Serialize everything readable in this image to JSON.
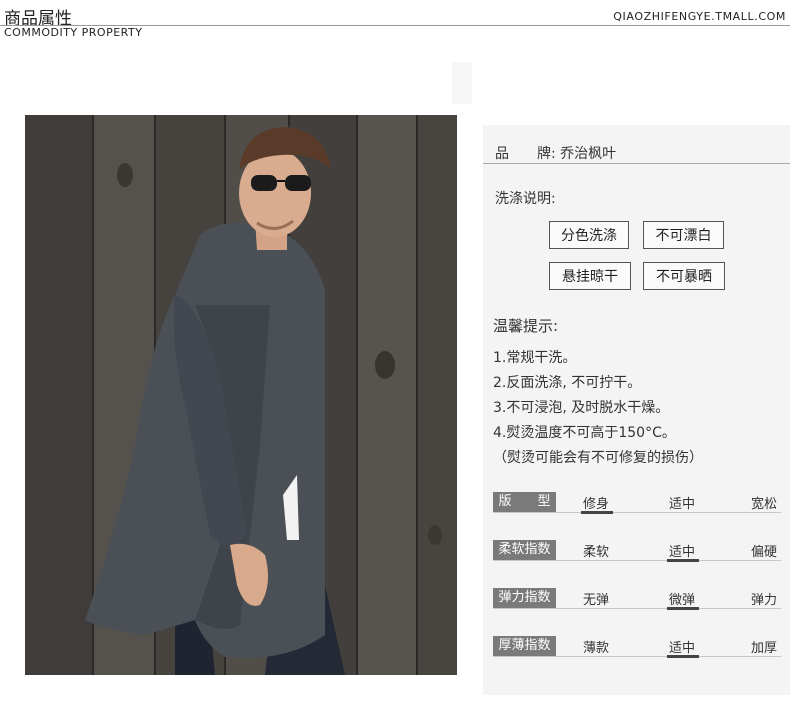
{
  "header": {
    "title": "商品属性",
    "subtitle": "COMMODITY  PROPERTY",
    "url": "QIAOZHIFENGYE.TMALL.COM"
  },
  "product": {
    "brand_line": "品　　牌: 乔治枫叶"
  },
  "wash": {
    "title": "洗涤说明:",
    "badges": [
      "分色洗涤",
      "不可漂白",
      "悬挂晾干",
      "不可暴晒"
    ]
  },
  "tips": {
    "title": "温馨提示:",
    "items": [
      "1.常规干洗。",
      "2.反面洗涤, 不可拧干。",
      "3.不可浸泡, 及时脱水干燥。",
      "4.熨烫温度不可高于150°C。",
      "（熨烫可能会有不可修复的损伤）"
    ]
  },
  "attributes": [
    {
      "label": "版　　型",
      "options": [
        "修身",
        "适中",
        "宽松"
      ],
      "selected": 0
    },
    {
      "label": "柔软指数",
      "options": [
        "柔软",
        "适中",
        "偏硬"
      ],
      "selected": 1
    },
    {
      "label": "弹力指数",
      "options": [
        "无弹",
        "微弹",
        "弹力"
      ],
      "selected": 1
    },
    {
      "label": "厚薄指数",
      "options": [
        "薄款",
        "适中",
        "加厚"
      ],
      "selected": 1
    }
  ],
  "colors": {
    "label_bg": "#7a7a7a",
    "panel_bg": "#f4f4f4",
    "coat": "#4b5057",
    "wood": "#4a4744"
  }
}
